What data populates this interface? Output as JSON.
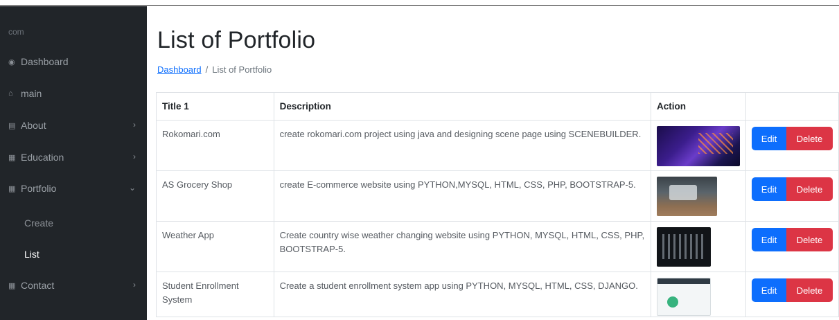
{
  "sidebar": {
    "brand": "com",
    "items": [
      {
        "label": "Dashboard",
        "icon": "speedometer-icon"
      },
      {
        "label": "main",
        "icon": "home-icon"
      },
      {
        "label": "About",
        "icon": "columns-icon"
      },
      {
        "label": "Education",
        "icon": "table-icon"
      },
      {
        "label": "Portfolio",
        "icon": "table-icon"
      },
      {
        "label": "Contact",
        "icon": "table-icon"
      }
    ],
    "portfolio_sub": [
      {
        "label": "Create"
      },
      {
        "label": "List"
      }
    ]
  },
  "main": {
    "title": "List of Portfolio",
    "breadcrumb": {
      "link": "Dashboard",
      "separator": "/",
      "current": "List of Portfolio"
    },
    "table": {
      "headers": [
        "Title 1",
        "Description",
        "Action",
        ""
      ],
      "rows": [
        {
          "title": "Rokomari.com",
          "description": "create rokomari.com project using java and designing scene page using SCENEBUILDER."
        },
        {
          "title": "AS Grocery Shop",
          "description": "create E-commerce website using PYTHON,MYSQL, HTML, CSS, PHP, BOOTSTRAP-5."
        },
        {
          "title": "Weather App",
          "description": "Create country wise weather changing website using PYTHON, MYSQL, HTML, CSS, PHP, BOOTSTRAP-5."
        },
        {
          "title": "Student Enrollment System",
          "description": "Create a student enrollment system app using PYTHON, MYSQL, HTML, CSS, DJANGO."
        }
      ],
      "edit_label": "Edit",
      "delete_label": "Delete"
    }
  },
  "colors": {
    "sidebar_bg": "#212529",
    "primary": "#0d6efd",
    "danger": "#dc3545"
  }
}
